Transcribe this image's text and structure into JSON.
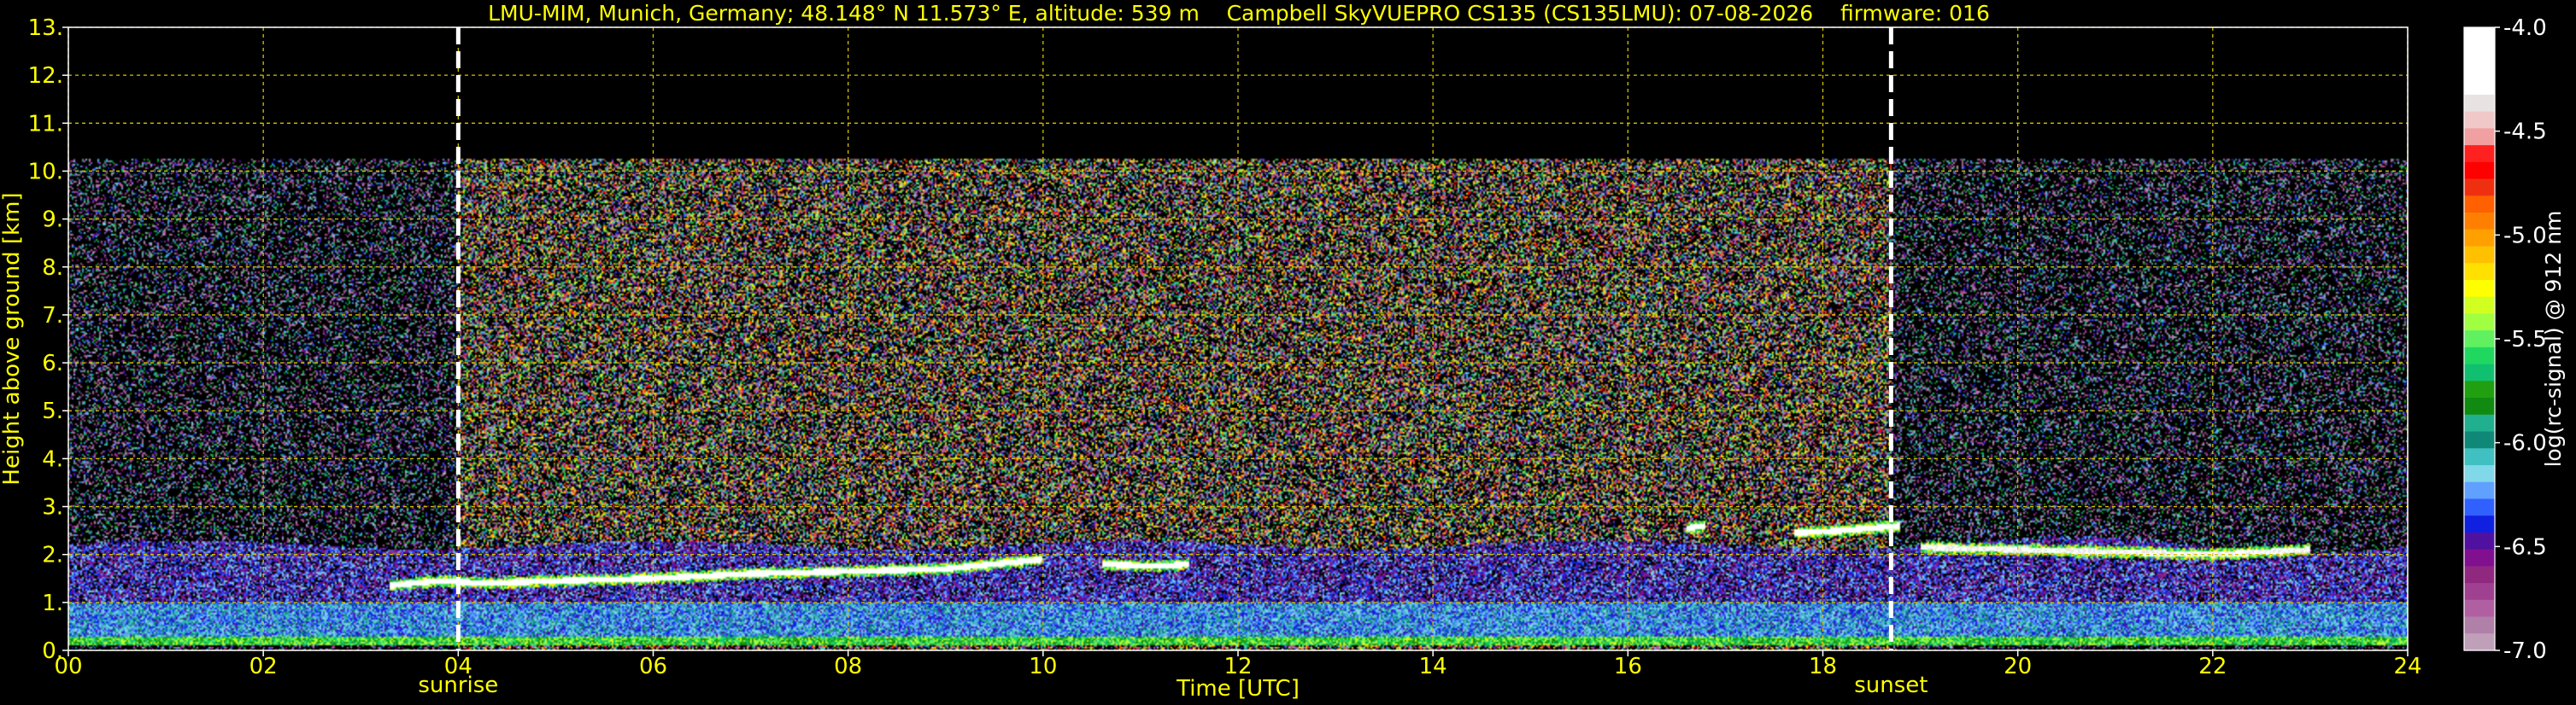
{
  "chart_data": {
    "type": "heatmap",
    "title": "LMU-MIM, Munich, Germany; 48.148° N 11.573° E, altitude: 539 m    Campbell SkyVUEPRO CS135 (CS135LMU): 07-08-2026    firmware: 016",
    "xlabel": "Time [UTC]",
    "ylabel": "Height above ground [km]",
    "xlim": [
      0,
      24
    ],
    "ylim": [
      0,
      13
    ],
    "x_ticks": [
      0,
      2,
      4,
      6,
      8,
      10,
      12,
      14,
      16,
      18,
      20,
      22,
      24
    ],
    "x_tick_labels": [
      "00",
      "02",
      "04",
      "06",
      "08",
      "10",
      "12",
      "14",
      "16",
      "18",
      "20",
      "22",
      "24"
    ],
    "y_ticks": [
      0,
      1,
      2,
      3,
      4,
      5,
      6,
      7,
      8,
      9,
      10,
      11,
      12,
      13
    ],
    "y_tick_labels": [
      "0.",
      "1.",
      "2.",
      "3.",
      "4.",
      "5.",
      "6.",
      "7.",
      "8.",
      "9.",
      "10.",
      "11.",
      "12.",
      "13."
    ],
    "grid": true,
    "data_top_km": 10.25,
    "events": [
      {
        "label": "sunrise",
        "time": 4.0
      },
      {
        "label": "sunset",
        "time": 18.7
      }
    ],
    "colorbar": {
      "label": "log(rc-signal) @ 912 nm",
      "range": [
        -7.0,
        -4.0
      ],
      "ticks": [
        -4.0,
        -4.5,
        -5.0,
        -5.5,
        -6.0,
        -6.5,
        -7.0
      ],
      "tick_labels": [
        "-4.0",
        "-4.5",
        "-5.0",
        "-5.5",
        "-6.0",
        "-6.5",
        "-7.0"
      ],
      "colors_top_to_bottom": [
        "#ffffff",
        "#ffffff",
        "#ffffff",
        "#ffffff",
        "#e8e2e2",
        "#f0c8c8",
        "#f0a0a0",
        "#ff2020",
        "#ff0000",
        "#ee3010",
        "#ff6000",
        "#ff8000",
        "#ffa000",
        "#ffc000",
        "#ffe000",
        "#ffff00",
        "#d0ff20",
        "#a0ff40",
        "#60f060",
        "#20d860",
        "#10c070",
        "#20a010",
        "#108a10",
        "#20b090",
        "#108878",
        "#40c0c0",
        "#80d8e8",
        "#60a0ff",
        "#3060ff",
        "#1020e0",
        "#5010a0",
        "#801090",
        "#902880",
        "#a04090",
        "#b060a0",
        "#b080a8",
        "#c0a0b8"
      ]
    },
    "layers": [
      {
        "name": "surface layer",
        "time": [
          0,
          24
        ],
        "base_km": 0.1,
        "top_km": 0.3,
        "log_signal": -5.6
      },
      {
        "name": "boundary layer",
        "time": [
          0,
          24
        ],
        "base_km": 0.3,
        "top_km": 1.0,
        "log_signal": -6.2
      },
      {
        "name": "residual layer",
        "time": [
          0,
          24
        ],
        "base_km": 1.0,
        "top_km": 2.2,
        "log_signal": -6.4
      }
    ],
    "cloud_tracks": [
      {
        "name": "layer-top cloud",
        "points": [
          [
            3.3,
            1.35
          ],
          [
            3.8,
            1.45
          ],
          [
            4.3,
            1.4
          ],
          [
            5.0,
            1.45
          ],
          [
            6.0,
            1.5
          ],
          [
            7.0,
            1.6
          ],
          [
            8.0,
            1.65
          ],
          [
            9.0,
            1.7
          ],
          [
            10.0,
            1.9
          ]
        ],
        "log_signal": -4.2
      },
      {
        "name": "cloud 11h",
        "points": [
          [
            10.6,
            1.8
          ],
          [
            11.2,
            1.75
          ],
          [
            11.5,
            1.8
          ]
        ],
        "log_signal": -4.2
      },
      {
        "name": "cloud 17.5h",
        "points": [
          [
            16.6,
            2.55
          ],
          [
            16.8,
            2.6
          ]
        ],
        "log_signal": -4.3
      },
      {
        "name": "cloud 18-19h",
        "points": [
          [
            17.7,
            2.45
          ],
          [
            18.2,
            2.5
          ],
          [
            18.8,
            2.6
          ]
        ],
        "log_signal": -4.3
      },
      {
        "name": "convective cloud base",
        "points": [
          [
            19.0,
            2.15
          ],
          [
            20.0,
            2.1
          ],
          [
            21.0,
            2.05
          ],
          [
            22.0,
            2.0
          ],
          [
            23.0,
            2.1
          ]
        ],
        "log_signal": -4.4
      }
    ]
  }
}
